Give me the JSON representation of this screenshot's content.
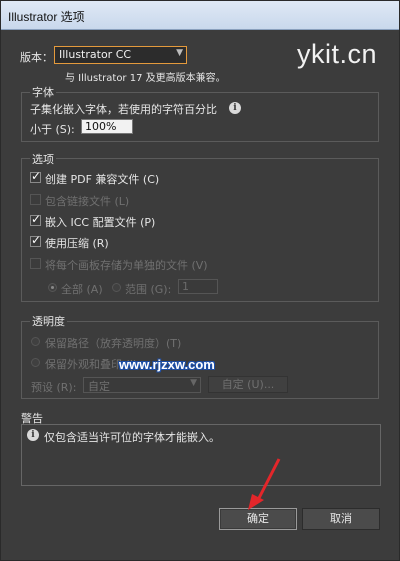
{
  "window": {
    "title": "Illustrator 选项"
  },
  "watermark": "ykit.cn",
  "watermark2": "www.rjzxw.com",
  "version": {
    "label": "版本：",
    "selected": "Illustrator CC",
    "note": "与 Illustrator 17 及更高版本兼容。"
  },
  "fonts": {
    "title": "字体",
    "desc": "子集化嵌入字体，若使用的字符百分比",
    "less_label": "小于 (S):",
    "percent": "100%"
  },
  "options": {
    "title": "选项",
    "items": [
      {
        "label": "创建 PDF 兼容文件 (C)",
        "checked": true,
        "enabled": true
      },
      {
        "label": "包含链接文件 (L)",
        "checked": false,
        "enabled": false
      },
      {
        "label": "嵌入 ICC 配置文件 (P)",
        "checked": true,
        "enabled": true
      },
      {
        "label": "使用压缩 (R)",
        "checked": true,
        "enabled": true
      },
      {
        "label": "将每个画板存储为单独的文件 (V)",
        "checked": false,
        "enabled": false
      }
    ],
    "all_label": "全部 (A)",
    "range_label": "范围 (G):",
    "range_value": "1"
  },
  "transparency": {
    "title": "透明度",
    "preserve_paths": "保留路径（放弃透明度）(T)",
    "preserve_appearance": "保留外观和叠印 (I)",
    "preset_label": "预设 (R):",
    "preset_value": "自定",
    "custom_button": "自定 (U)..."
  },
  "warning": {
    "title": "警告",
    "text": "仅包含适当许可位的字体才能嵌入。"
  },
  "buttons": {
    "ok": "确定",
    "cancel": "取消"
  },
  "colors": {
    "accent_focus": "#e49a3c",
    "annotation_arrow": "#e3262a"
  }
}
